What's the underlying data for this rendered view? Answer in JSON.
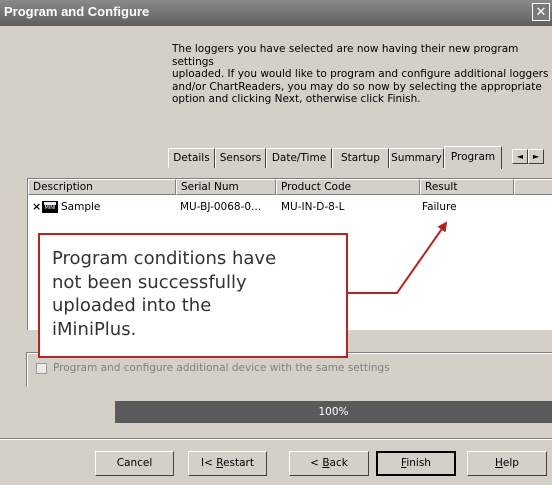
{
  "window": {
    "title": "Program and Configure",
    "close_glyph": "✕"
  },
  "instructions": "The loggers you have selected are now having their new program settings\nuploaded. If you would like to program and configure additional loggers\nand/or ChartReaders, you may do so now by selecting the appropriate\noption and clicking Next, otherwise click Finish.",
  "tabs": [
    "Details",
    "Sensors",
    "Date/Time",
    "Startup",
    "Summary",
    "Program"
  ],
  "active_tab": "Program",
  "tab_scroll": {
    "left": "◄",
    "right": "►"
  },
  "table": {
    "columns": [
      "Description",
      "Serial Num",
      "Product Code",
      "Result"
    ],
    "rows": [
      {
        "status_mark": "×",
        "icon": "device-icon",
        "icon_text": "MINI",
        "description": "Sample",
        "serial": "MU-BJ-0068-0...",
        "product_code": "MU-IN-D-8-L",
        "result": "Failure"
      }
    ]
  },
  "callout": "Program conditions have\nnot been successfully\nuploaded into the\niMiniPlus.",
  "checkbox": {
    "label": "Program and configure additional device with the same settings",
    "checked": false,
    "enabled": false
  },
  "progress": {
    "text": "100%",
    "value": 1.0
  },
  "buttons": {
    "cancel": "Cancel",
    "restart_prefix": "I< ",
    "restart_key": "R",
    "restart_rest": "estart",
    "back_prefix": "< ",
    "back_key": "B",
    "back_rest": "ack",
    "finish_key": "F",
    "finish_rest": "inish",
    "help_key": "H",
    "help_rest": "elp"
  },
  "colors": {
    "callout_border": "#b32424",
    "progress_fill": "#5a5a5a",
    "titlebar": "#6e6e6e"
  }
}
